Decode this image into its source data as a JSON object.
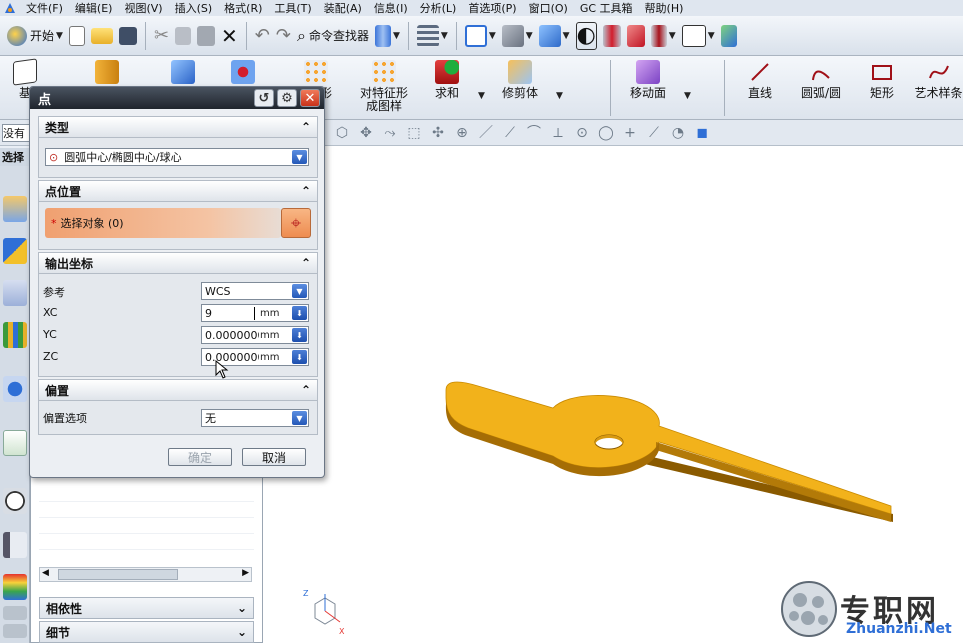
{
  "menubar": {
    "items": [
      "文件(F)",
      "编辑(E)",
      "视图(V)",
      "插入(S)",
      "格式(R)",
      "工具(T)",
      "装配(A)",
      "信息(I)",
      "分析(L)",
      "首选项(P)",
      "窗口(O)",
      "GC 工具箱",
      "帮助(H)"
    ]
  },
  "toolbar1": {
    "start_label": "开始",
    "command_finder_label": "命令查找器"
  },
  "toolbar2": {
    "items": [
      "基准",
      "修剪体",
      "求和",
      "对特征形\n成图样",
      "移动面",
      "直线",
      "圆弧/圆",
      "矩形",
      "艺术样条"
    ],
    "partial_left": "基",
    "partial_mid": "形"
  },
  "selection_bar": {
    "filter_value": "没有"
  },
  "left_label": "选择",
  "navigator": {
    "sections": [
      "相依性",
      "细节"
    ]
  },
  "dialog": {
    "title": "点",
    "type_section": {
      "header": "类型",
      "selected": "圆弧中心/椭圆中心/球心"
    },
    "point_section": {
      "header": "点位置",
      "select_label": "选择对象 (0)"
    },
    "output_section": {
      "header": "输出坐标",
      "reference_label": "参考",
      "reference_value": "WCS",
      "xc_label": "XC",
      "xc_value": "9",
      "yc_label": "YC",
      "yc_value": "0.0000000(",
      "zc_label": "ZC",
      "zc_value": "0.0000000(",
      "unit": "mm"
    },
    "offset_section": {
      "header": "偏置",
      "option_label": "偏置选项",
      "option_value": "无"
    },
    "ok_label": "确定",
    "cancel_label": "取消"
  },
  "watermark": {
    "text": "专职网",
    "url": "Zhuanzhi.Net"
  },
  "colors": {
    "part_fill": "#f2b21b",
    "part_edge": "#8a5a00",
    "title_bar": "#2b323c",
    "accent_blue": "#2458b8",
    "select_row": "#f0a878"
  }
}
